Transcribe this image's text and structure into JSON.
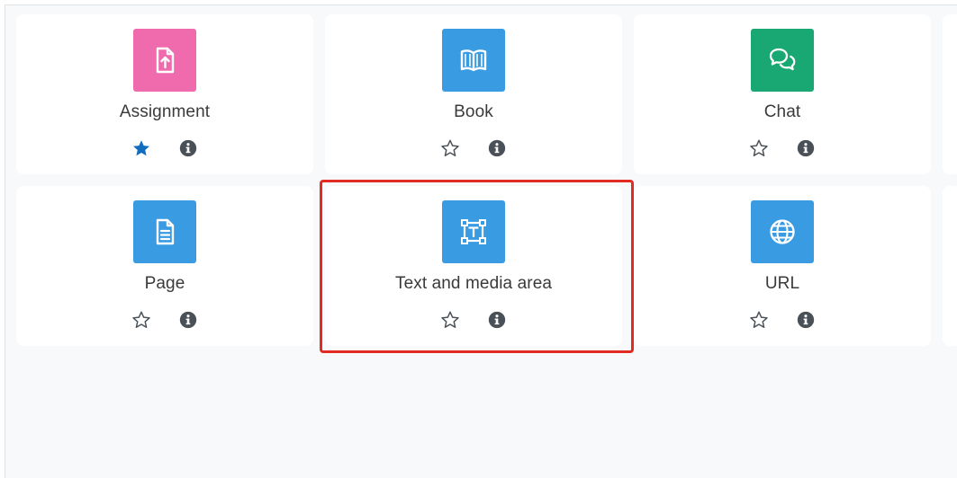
{
  "colors": {
    "assessment": "#f06bae",
    "content": "#399be2",
    "collaboration": "#19a774",
    "starred": "#0f6cbf",
    "icon_muted": "#495057",
    "highlight": "#e22b22"
  },
  "modules": [
    {
      "label": "Assignment",
      "icon": "assignment-icon",
      "starred": true
    },
    {
      "label": "Book",
      "icon": "book-icon",
      "starred": false
    },
    {
      "label": "Chat",
      "icon": "chat-icon",
      "starred": false
    },
    {
      "label": "Page",
      "icon": "page-icon",
      "starred": false
    },
    {
      "label": "Text and media area",
      "icon": "text-media-icon",
      "starred": false
    },
    {
      "label": "URL",
      "icon": "globe-icon",
      "starred": false
    }
  ]
}
